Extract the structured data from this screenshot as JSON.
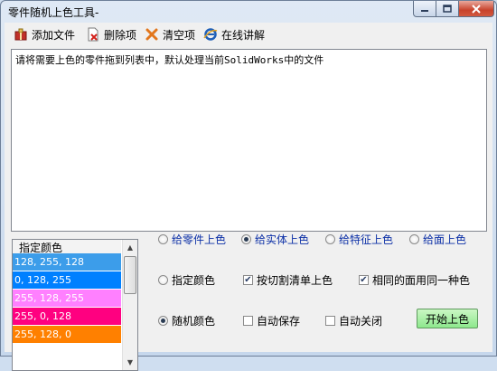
{
  "window": {
    "title": "零件随机上色工具-"
  },
  "toolbar": {
    "add_file": "添加文件",
    "delete_item": "删除项",
    "clear_items": "清空项",
    "online_guide": "在线讲解"
  },
  "hint_text": "请将需要上色的零件拖到列表中，默认处理当前SolidWorks中的文件",
  "color_list": {
    "header": "指定颜色",
    "rows": [
      {
        "label": "128, 255, 128",
        "color": "#3c9dea"
      },
      {
        "label": "0, 128, 255",
        "color": "#0080ff"
      },
      {
        "label": "255, 128, 255",
        "color": "#ff80ff"
      },
      {
        "label": "255, 0, 128",
        "color": "#ff0080"
      },
      {
        "label": "255, 128, 0",
        "color": "#ff8000"
      }
    ]
  },
  "target_options": {
    "part": "给零件上色",
    "body": "给实体上色",
    "feature": "给特征上色",
    "face": "给面上色",
    "selected": "body"
  },
  "color_mode": {
    "specified": "指定颜色",
    "random": "随机颜色",
    "selected": "random"
  },
  "options": {
    "by_cut_list": {
      "label": "按切割清单上色",
      "checked": true
    },
    "same_face_color": {
      "label": "相同的面用同一种色",
      "checked": true
    },
    "auto_save": {
      "label": "自动保存",
      "checked": false
    },
    "auto_close": {
      "label": "自动关闭",
      "checked": false
    }
  },
  "start_button": "开始上色"
}
